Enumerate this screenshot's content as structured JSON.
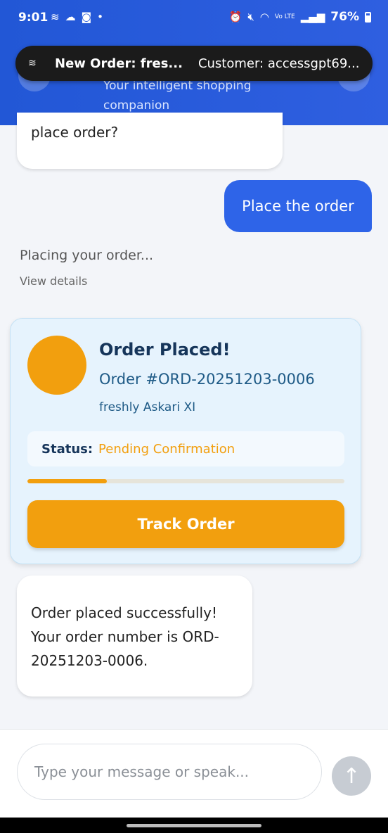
{
  "status_bar": {
    "time": "9:01",
    "left_icons": [
      "notification-app-icon",
      "cloud-icon",
      "instagram-icon",
      "dot-icon"
    ],
    "right_icons": [
      "alarm-icon",
      "mute-icon",
      "wifi-icon",
      "volte-icon",
      "signal-icon"
    ],
    "battery": "76%"
  },
  "header": {
    "subtitle": "Your intelligent shopping companion"
  },
  "notification": {
    "title": "New Order: fres...",
    "body": "Customer: accessgpt69..."
  },
  "chat": {
    "bot_message_partial": "place order?",
    "user_message": "Place the order",
    "placing_status": "Placing your order...",
    "view_details": "View details",
    "success_message": "Order placed successfully! Your order number is ORD-20251203-0006."
  },
  "order_card": {
    "title": "Order Placed!",
    "order_number": "Order #ORD-20251203-0006",
    "store": "freshly Askari XI",
    "status_label": "Status:",
    "status_value": "Pending Confirmation",
    "progress_fraction": 0.25,
    "track_button": "Track Order",
    "accent_color": "#f29f0e"
  },
  "input": {
    "placeholder": "Type your message or speak...",
    "send_icon": "arrow-up-icon"
  },
  "colors": {
    "header_blue": "#2257d6",
    "user_bubble": "#2e64e8",
    "accent_orange": "#f29f0e"
  }
}
